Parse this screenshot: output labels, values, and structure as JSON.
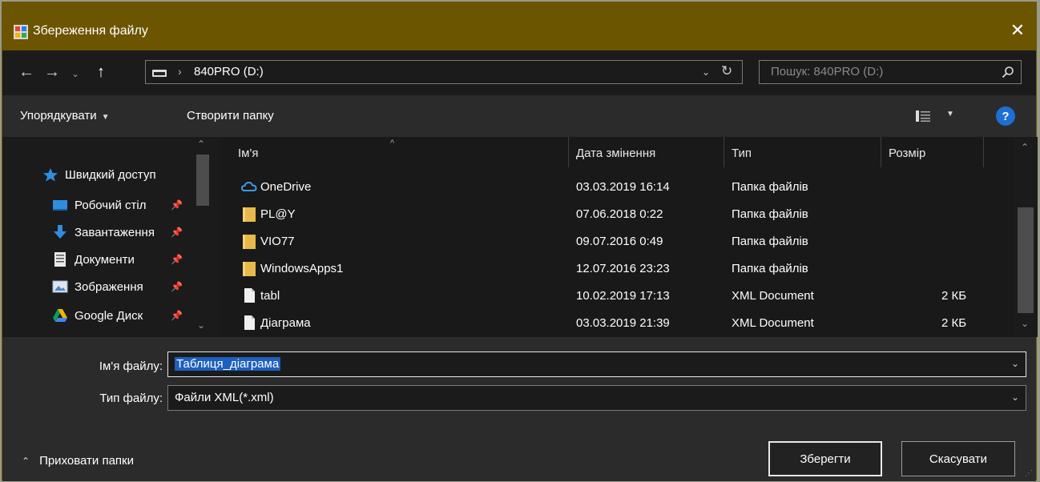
{
  "window": {
    "title": "Збереження файлу",
    "close_glyph": "✕"
  },
  "nav": {
    "back": "←",
    "forward": "→",
    "recent": "⌄",
    "up": "↑"
  },
  "address": {
    "separator": "›",
    "path": "840PRO (D:)",
    "dropdown": "⌄",
    "refresh": "↻"
  },
  "search": {
    "placeholder": "Пошук: 840PRO (D:)"
  },
  "toolbar": {
    "organize_label": "Упорядкувати",
    "organize_arrow": "▼",
    "new_folder_label": "Створити папку",
    "view_arrow": "▼",
    "help_label": "?"
  },
  "sidebar": {
    "items": [
      {
        "label": "Швидкий доступ",
        "icon": "star-icon",
        "pinned": false
      },
      {
        "label": "Робочий стіл",
        "icon": "desktop-icon",
        "pinned": true
      },
      {
        "label": "Завантаження",
        "icon": "download-icon",
        "pinned": true
      },
      {
        "label": "Документи",
        "icon": "documents-icon",
        "pinned": true
      },
      {
        "label": "Зображення",
        "icon": "pictures-icon",
        "pinned": true
      },
      {
        "label": "Google Диск",
        "icon": "google-drive-icon",
        "pinned": true
      }
    ],
    "pin_glyph": "📌"
  },
  "filelist": {
    "columns": {
      "name": "Ім'я",
      "date": "Дата змінення",
      "type": "Тип",
      "size": "Розмір"
    },
    "rows": [
      {
        "name": "OneDrive",
        "date": "03.03.2019 16:14",
        "type": "Папка файлів",
        "size": "",
        "icon": "onedrive-icon"
      },
      {
        "name": "PL@Y",
        "date": "07.06.2018 0:22",
        "type": "Папка файлів",
        "size": "",
        "icon": "folder-icon"
      },
      {
        "name": "VIO77",
        "date": "09.07.2016 0:49",
        "type": "Папка файлів",
        "size": "",
        "icon": "folder-icon"
      },
      {
        "name": "WindowsApps1",
        "date": "12.07.2016 23:23",
        "type": "Папка файлів",
        "size": "",
        "icon": "folder-icon"
      },
      {
        "name": "tabl",
        "date": "10.02.2019 17:13",
        "type": "XML Document",
        "size": "2 КБ",
        "icon": "file-icon"
      },
      {
        "name": "Діаграма",
        "date": "03.03.2019 21:39",
        "type": "XML Document",
        "size": "2 КБ",
        "icon": "file-icon"
      }
    ]
  },
  "form": {
    "filename_label": "Ім'я файлу:",
    "filename_value": "Таблиця_діаграма",
    "filetype_label": "Тип файлу:",
    "filetype_value": "Файли XML(*.xml)",
    "dropdown": "⌄"
  },
  "footer": {
    "hide_folders_label": "Приховати папки",
    "hide_folders_chevron": "⌃",
    "save_label": "Зберегти",
    "cancel_label": "Скасувати"
  },
  "colors": {
    "titlebar": "#6b5500",
    "accent": "#1d6fd1",
    "folder": "#e8b94a",
    "selection": "#1e5fbf"
  }
}
